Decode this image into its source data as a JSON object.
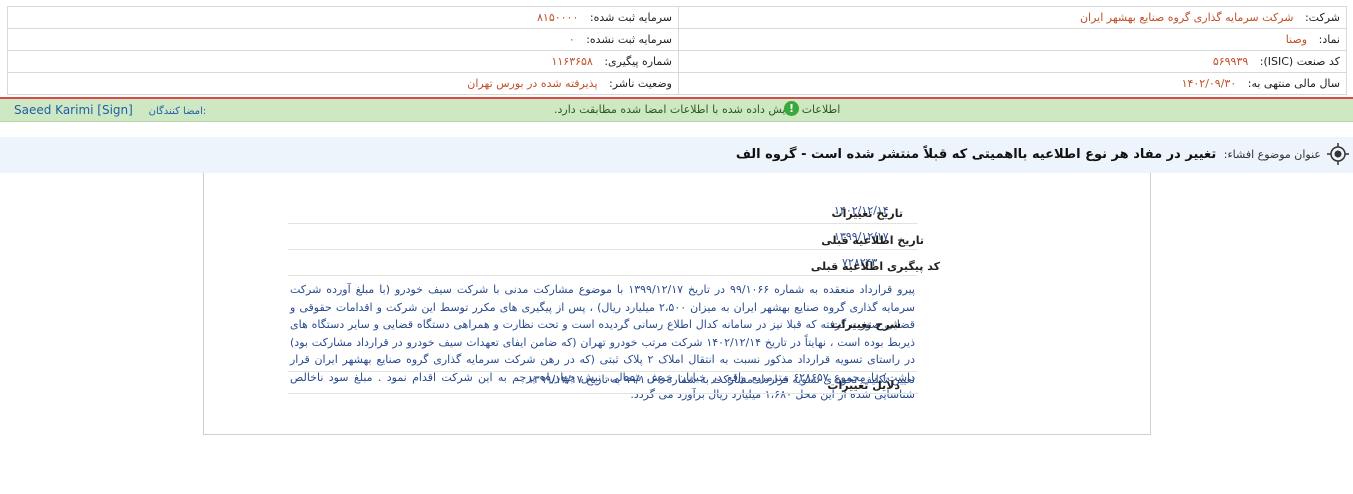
{
  "company": {
    "label": "شرکت:",
    "value": "شرکت سرمایه گذاری گروه صنایع بهشهر ایران"
  },
  "registered_capital": {
    "label": "سرمایه ثبت شده:",
    "value": "۸۱۵۰۰۰۰"
  },
  "symbol": {
    "label": "نماد:",
    "value": "وصنا"
  },
  "unregistered_capital": {
    "label": "سرمایه ثبت نشده:",
    "value": "۰"
  },
  "isic": {
    "label": "کد صنعت (ISIC):",
    "value": "۵۶۹۹۳۹"
  },
  "tracking_number": {
    "label": "شماره پیگیری:",
    "value": "۱۱۶۳۶۵۸"
  },
  "fiscal_year": {
    "label": "سال مالی منتهی به:",
    "value": "۱۴۰۲/۰۹/۳۰"
  },
  "publisher_status": {
    "label": "وضعیت ناشر:",
    "value": "پذیرفته شده در بورس تهران"
  },
  "signature": {
    "signers_label": "امضا کنندگان:",
    "signer_name": "Saeed Karimi [Sign]",
    "notice": "اطلاعات نمایش داده شده با اطلاعات امضا شده مطابقت دارد."
  },
  "disclosure": {
    "label": "عنوان موضوع افشاء:",
    "title": "تغییر در مفاد هر نوع اطلاعیه بااهمیتی که قبلاً منتشر شده است - گروه الف"
  },
  "details": {
    "change_date_label": "تاریخ تغییرات",
    "change_date": "۱۴۰۲/۱۲/۱۴",
    "prev_notice_date_label": "تاریخ اطلاعیه قبلی",
    "prev_notice_date": "۱۳۹۹/۱۲/۱۷",
    "prev_tracking_label": "کد پیگیری اطلاعیه قبلی",
    "prev_tracking": "۷۲۸۲۴۳",
    "description_label": "شرح تغییرات",
    "description": "پیرو قرارداد منعقده به شماره ۹۹/۱۰۶۶ در تاریخ ۱۳۹۹/۱۲/۱۷ با موضوع مشارکت مدنی با شرکت سیف خودرو (با مبلغ آورده شرکت سرمایه گذاری گروه صنایع بهشهر ایران به میزان ۲،۵۰۰ میلیارد ریال) ، پس از پیگیری های مکرر توسط این شرکت و اقدامات حقوقی و قضایی صورت گرفته که قبلا نیز در سامانه کدال اطلاع رسانی گردیده است و تحت نظارت و همراهی دستگاه قضایی و سایر دستگاه های ذیربط بوده است ، نهایتاً در تاریخ ۱۴۰۲/۱۲/۱۴ شرکت مرتب خودرو تهران (که ضامن ایفای تعهدات سیف خودرو در قرارداد مشارکت بود) در راستای تسویه قرارداد مذکور نسبت به انتقال املاک ۲ پلاک ثبتی (که در رهن شرکت سرمایه گذاری گروه صنایع بهشهر ایران قرار داشت) با مجموع ۶۲۸۶۵۷ مترمربع واقع در خیابان خوش شمالی، نبش چهارراه پرچم به این شرکت اقدام نمود . مبلغ سود ناخالص شناسایی شده از این محل ۱،۶۸۰ میلیارد ریال برآورد می گردد.",
    "reasons_label": "دلایل تغییرات",
    "reasons": "تعیین تکلیف نحوه ی تسویه قرارداد مشارکت به شماره ۹۹/۱۰۶۶ به تاریخ ۱۳۹۹/۱۲/۱۷"
  }
}
